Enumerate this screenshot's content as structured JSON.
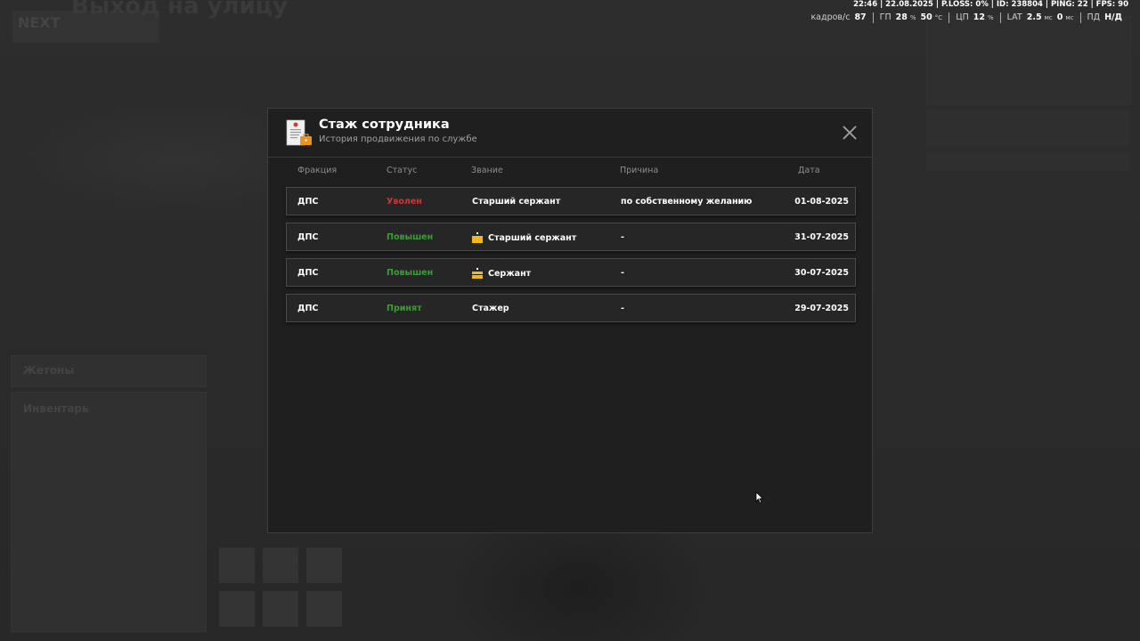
{
  "background": {
    "title": "Выход на улицу",
    "logo": "NEXT",
    "jetons_label": "Жетоны",
    "inventory_label": "Инвентарь"
  },
  "topline": "22:46 | 22.08.2025 | P.LOSS: 0% | ID: 238804 | PING: 22 | FPS: 90",
  "stats": {
    "fps_label": "кадров/с",
    "fps_value": "87",
    "gpu_label": "ГП",
    "gpu_load": "28",
    "gpu_temp": "50",
    "cpu_label": "ЦП",
    "cpu_load": "12",
    "lat_label": "LAT",
    "lat_value": "2.5",
    "lat_value2": "0",
    "pd_label": "ПД",
    "pd_value": "Н/Д",
    "percent": "%",
    "celsius": "°C",
    "ms": "мс"
  },
  "modal": {
    "title": "Стаж сотрудника",
    "subtitle": "История продвижения по службе",
    "columns": {
      "faction": "Фракция",
      "status": "Статус",
      "rank": "Звание",
      "reason": "Причина",
      "date": "Дата"
    },
    "rows": [
      {
        "faction": "ДПС",
        "status": "Уволен",
        "status_color": "#c93838",
        "rank": "Старший сержант",
        "rank_icon": null,
        "reason": "по собственному желанию",
        "date": "01-08-2025"
      },
      {
        "faction": "ДПС",
        "status": "Повышен",
        "status_color": "#3d9b38",
        "rank": "Старший сержант",
        "rank_icon": "senior-sergeant-insignia-icon",
        "reason": "-",
        "date": "31-07-2025"
      },
      {
        "faction": "ДПС",
        "status": "Повышен",
        "status_color": "#3d9b38",
        "rank": "Сержант",
        "rank_icon": "sergeant-insignia-icon",
        "reason": "-",
        "date": "30-07-2025"
      },
      {
        "faction": "ДПС",
        "status": "Принят",
        "status_color": "#3d9b38",
        "rank": "Стажер",
        "rank_icon": null,
        "reason": "-",
        "date": "29-07-2025"
      }
    ]
  },
  "colors": {
    "accent_yellow": "#f2b81a",
    "status_red": "#c93838",
    "status_green": "#3d9b38",
    "modal_bg": "#1f1f1f"
  }
}
